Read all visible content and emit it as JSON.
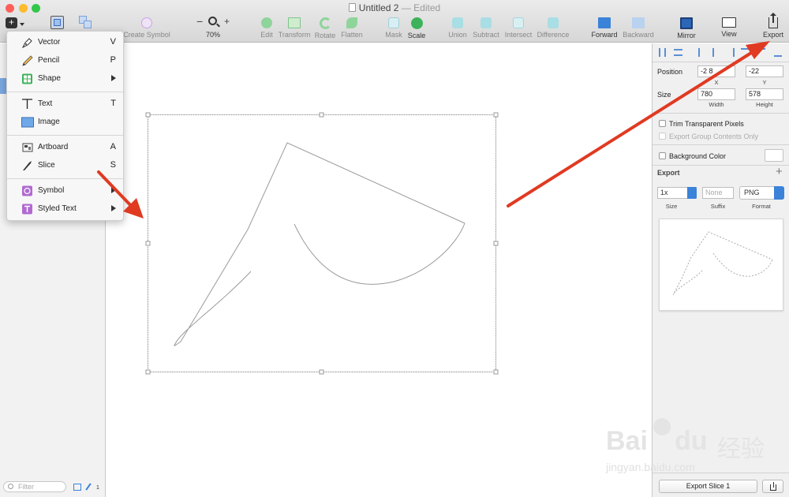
{
  "window": {
    "title": "Untitled 2",
    "separator": "—",
    "status": "Edited"
  },
  "toolbar": {
    "zoom_value": "70%",
    "zoom_minus": "−",
    "zoom_plus": "+",
    "items": {
      "create_symbol": "Create Symbol",
      "edit": "Edit",
      "transform": "Transform",
      "rotate": "Rotate",
      "flatten": "Flatten",
      "mask": "Mask",
      "scale": "Scale",
      "union": "Union",
      "subtract": "Subtract",
      "intersect": "Intersect",
      "difference": "Difference",
      "forward": "Forward",
      "backward": "Backward",
      "mirror": "Mirror",
      "view": "View",
      "export": "Export"
    }
  },
  "insert_menu": {
    "items": [
      {
        "label": "Vector",
        "shortcut": "V"
      },
      {
        "label": "Pencil",
        "shortcut": "P"
      },
      {
        "label": "Shape",
        "shortcut": ""
      },
      {
        "label": "Text",
        "shortcut": "T"
      },
      {
        "label": "Image",
        "shortcut": ""
      },
      {
        "label": "Artboard",
        "shortcut": "A"
      },
      {
        "label": "Slice",
        "shortcut": "S"
      },
      {
        "label": "Symbol",
        "shortcut": ""
      },
      {
        "label": "Styled Text",
        "shortcut": ""
      }
    ]
  },
  "sidebar": {
    "filter_placeholder": "Filter",
    "layer_count": "1"
  },
  "inspector": {
    "position_label": "Position",
    "x_value": "-2 8",
    "y_value": "-22",
    "x_caption": "X",
    "y_caption": "Y",
    "size_label": "Size",
    "width_value": "780",
    "height_value": "578",
    "width_caption": "Width",
    "height_caption": "Height",
    "trim_label": "Trim Transparent Pixels",
    "export_group_label": "Export Group Contents Only",
    "background_label": "Background Color",
    "export_header": "Export",
    "export_add": "+",
    "scale_value": "1x",
    "suffix_placeholder": "None",
    "format_value": "PNG",
    "size_caption": "Size",
    "suffix_caption": "Suffix",
    "format_caption": "Format",
    "export_slice_button": "Export Slice 1"
  },
  "watermark": {
    "brand": "Bai",
    "brand_end": "du",
    "cn": "经验",
    "url": "jingyan.baidu.com"
  },
  "colors": {
    "accent": "#3b82d9",
    "arrow": "#e03a22",
    "close": "#fc5f57",
    "minimize": "#fdbb2d",
    "zoom": "#33c748"
  }
}
